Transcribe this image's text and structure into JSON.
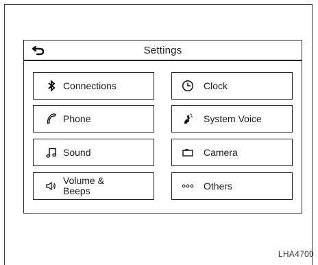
{
  "header": {
    "title": "Settings",
    "back_icon": "back-arrow-icon"
  },
  "tiles": [
    {
      "label": "Connections",
      "icon": "bluetooth-icon"
    },
    {
      "label": "Clock",
      "icon": "clock-icon"
    },
    {
      "label": "Phone",
      "icon": "phone-icon"
    },
    {
      "label": "System Voice",
      "icon": "voice-icon"
    },
    {
      "label": "Sound",
      "icon": "music-note-icon"
    },
    {
      "label": "Camera",
      "icon": "camera-icon"
    },
    {
      "label": "Volume & Beeps",
      "icon": "speaker-icon"
    },
    {
      "label": "Others",
      "icon": "more-dots-icon"
    }
  ],
  "figure_code": "LHA4700"
}
